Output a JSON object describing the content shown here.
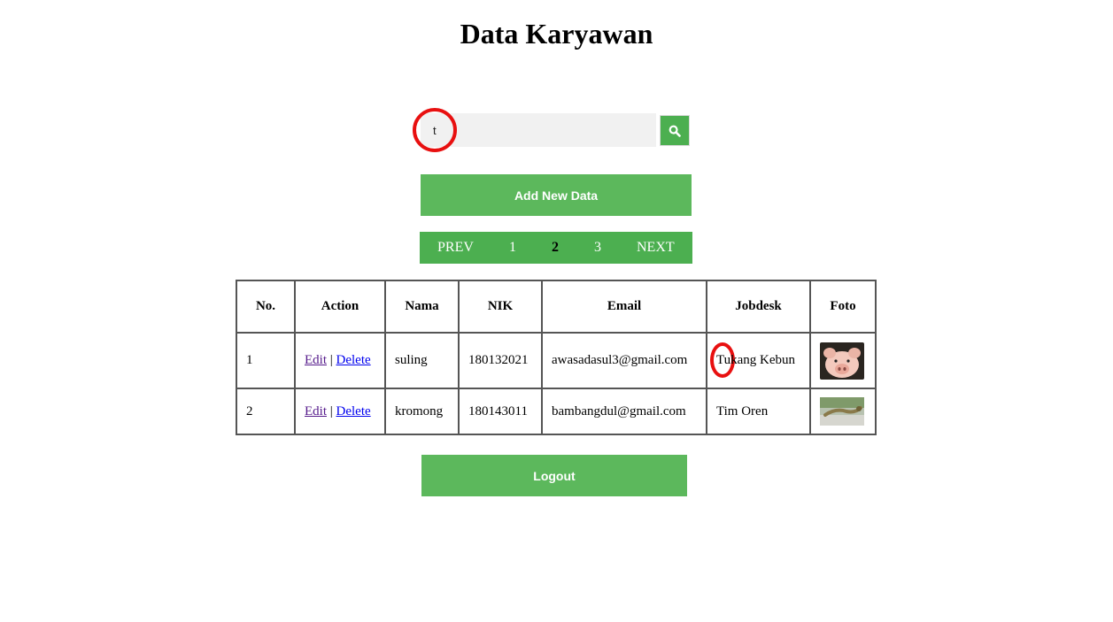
{
  "page": {
    "title": "Data Karyawan"
  },
  "search": {
    "value": "t",
    "button_icon": "search-icon"
  },
  "buttons": {
    "add_new": "Add New Data",
    "logout": "Logout"
  },
  "pagination": {
    "prev": "PREV",
    "pages": [
      "1",
      "2",
      "3"
    ],
    "current": "2",
    "next": "NEXT"
  },
  "table": {
    "headers": [
      "No.",
      "Action",
      "Nama",
      "NIK",
      "Email",
      "Jobdesk",
      "Foto"
    ],
    "action_edit": "Edit",
    "action_sep": "|",
    "action_delete": "Delete",
    "rows": [
      {
        "no": "1",
        "nama": "suling",
        "nik": "180132021",
        "email": "awasadasul3@gmail.com",
        "jobdesk": "Tukang Kebun",
        "foto": "pig-photo"
      },
      {
        "no": "2",
        "nama": "kromong",
        "nik": "180143011",
        "email": "bambangdul@gmail.com",
        "jobdesk": "Tim Oren",
        "foto": "lizard-photo"
      }
    ]
  },
  "colors": {
    "green": "#4caf50",
    "button_green": "#5cb85c",
    "annotation_red": "#e81010"
  }
}
